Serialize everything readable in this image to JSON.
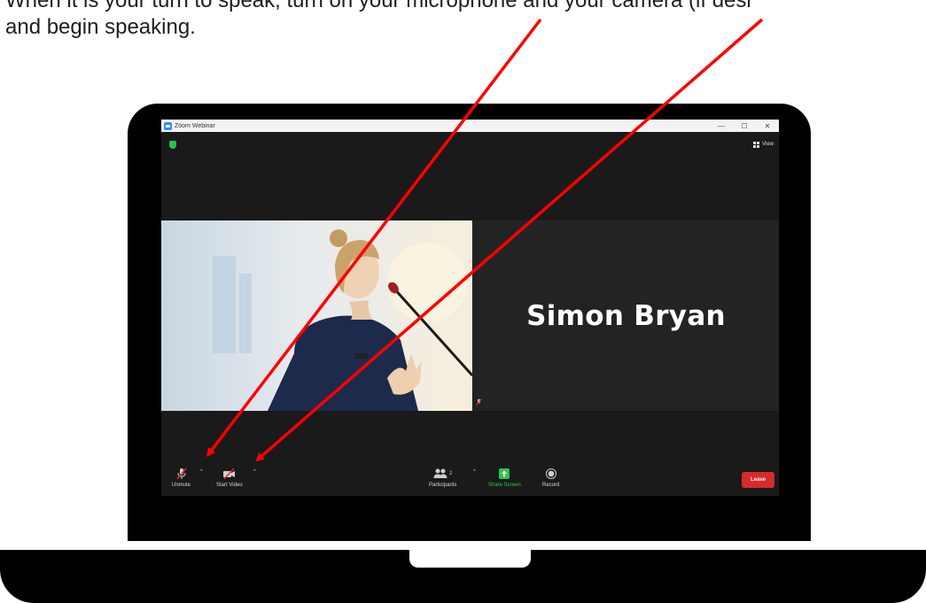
{
  "instruction": {
    "text": "When it is your turn to speak, turn on your microphone and your camera (if desi\nand begin speaking."
  },
  "window": {
    "title": "Zoom Webinar",
    "minimize": "—",
    "maximize": "☐",
    "close": "✕",
    "view_label": "View"
  },
  "tiles": {
    "right_name": "Simon Bryan"
  },
  "toolbar": {
    "unmute_label": "Unmute",
    "start_video_label": "Start Video",
    "participants_label": "Participants",
    "participants_count": "2",
    "share_screen_label": "Share Screen",
    "record_label": "Record",
    "leave_label": "Leave",
    "caret": "^"
  },
  "colors": {
    "leave": "#d62b2b",
    "share_green": "#2fc44f",
    "annotation_arrow": "#ff0000",
    "zoom_blue": "#2d8cff"
  },
  "icons": {
    "mic": "microphone-muted-icon",
    "video": "video-off-icon",
    "participants": "participants-icon",
    "share": "share-screen-icon",
    "record": "record-icon"
  }
}
